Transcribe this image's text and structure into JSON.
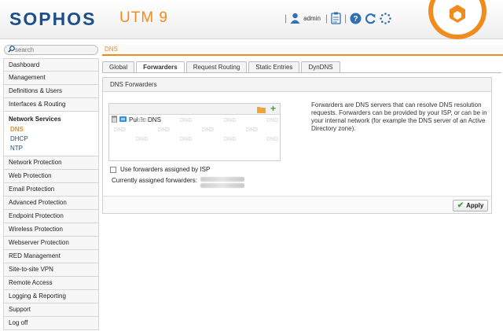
{
  "header": {
    "logo": "SOPHOS",
    "product": "UTM 9",
    "separator": "|",
    "username": "admin"
  },
  "search": {
    "placeholder": "search"
  },
  "breadcrumb": "DNS",
  "sidebar": {
    "items_top": [
      "Dashboard",
      "Management",
      "Definitions & Users",
      "Interfaces & Routing"
    ],
    "group": {
      "title": "Network Services",
      "subitems": [
        "DNS",
        "DHCP",
        "NTP"
      ],
      "active": "DNS"
    },
    "items_bottom": [
      "Network Protection",
      "Web Protection",
      "Email Protection",
      "Advanced Protection",
      "Endpoint Protection",
      "Wireless Protection",
      "Webserver Protection",
      "RED Management",
      "Site-to-site VPN",
      "Remote Access",
      "Logging & Reporting",
      "Support",
      "Log off"
    ]
  },
  "tabs": [
    "Global",
    "Forwarders",
    "Request Routing",
    "Static Entries",
    "DynDNS"
  ],
  "active_tab": "Forwarders",
  "panel": {
    "title": "DNS Forwarders",
    "list_items": [
      "Public DNS"
    ],
    "watermark": "DND",
    "description": "Forwarders are DNS servers that can resolve DNS resolution requests. Forwarders can be provided by your ISP, or can be in your internal network (for example the DNS server of an Active Directory zone).",
    "checkbox_label": "Use forwarders assigned by ISP",
    "assigned_label": "Currently assigned forwarders:",
    "apply_label": "Apply"
  },
  "colors": {
    "brand_blue": "#1b4f8a",
    "accent_orange": "#f08c1e",
    "add_green": "#39a23a"
  }
}
